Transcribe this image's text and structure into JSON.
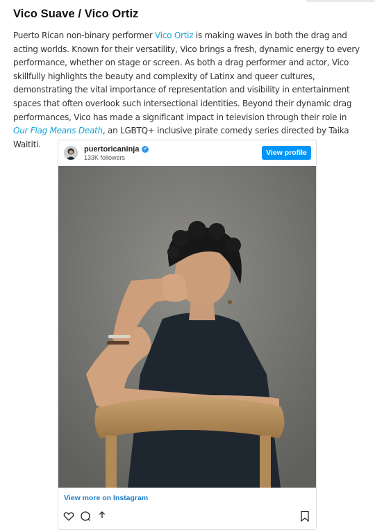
{
  "article": {
    "heading": "Vico Suave / Vico Ortiz",
    "p_intro": "Puerto Rican non-binary performer ",
    "p_link": "Vico Ortiz",
    "p_mid": " is making waves in both the drag and acting worlds. Known for their versatility, Vico brings a fresh, dynamic energy to every performance, whether on stage or screen. As both a drag performer and actor, Vico skillfully highlights the beauty and complexity of Latinx and queer cultures, demonstrating the vital importance of representation and visibility in entertainment spaces that often overlook such intersectional identities. Beyond their dynamic drag performances, Vico has made a significant impact in television through their role in ",
    "p_show": "Our Flag Means Death",
    "p_end": ", an LGBTQ+ inclusive pirate comedy series directed by Taika Waititi."
  },
  "instagram": {
    "username": "puertoricaninja",
    "followers": "133K followers",
    "view_profile": "View profile",
    "view_more": "View more on Instagram",
    "icons": [
      "verified-badge-icon",
      "heart-icon",
      "comment-icon",
      "share-icon",
      "bookmark-icon"
    ]
  },
  "colors": {
    "link": "#1aa3d9",
    "button": "#0095f6"
  }
}
